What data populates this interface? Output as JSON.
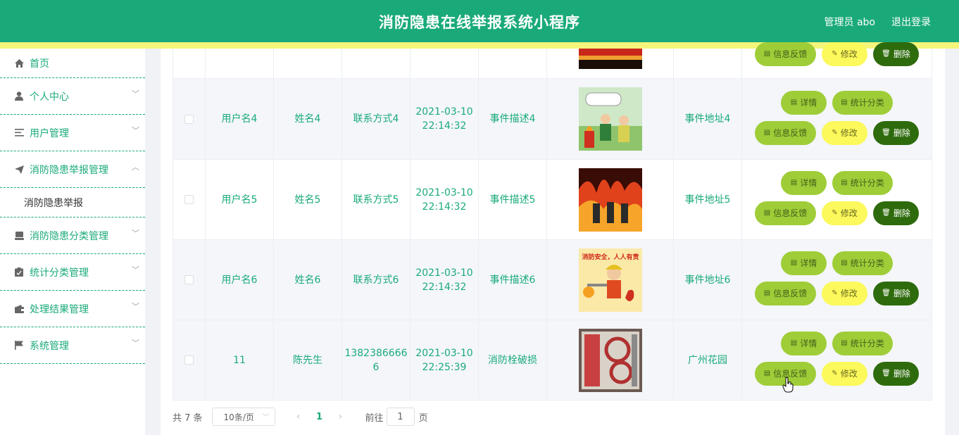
{
  "header": {
    "title": "消防隐患在线举报系统小程序",
    "admin": "管理员 abo",
    "logout": "退出登录"
  },
  "sidebar": {
    "items": [
      {
        "label": "首页",
        "icon": "home-icon"
      },
      {
        "label": "个人中心",
        "icon": "user-icon"
      },
      {
        "label": "用户管理",
        "icon": "list-icon"
      },
      {
        "label": "消防隐患举报管理",
        "icon": "send-icon"
      },
      {
        "label": "消防隐患分类管理",
        "icon": "tray-icon"
      },
      {
        "label": "统计分类管理",
        "icon": "clipboard-icon"
      },
      {
        "label": "处理结果管理",
        "icon": "wallet-icon"
      },
      {
        "label": "系统管理",
        "icon": "flag-icon"
      }
    ],
    "sub_item": "消防隐患举报"
  },
  "table": {
    "rows": [
      {
        "username": "用户名4",
        "name": "姓名4",
        "contact": "联系方式4",
        "date": "2021-03-10",
        "time": "22:14:32",
        "desc": "事件描述4",
        "address": "事件地址4",
        "image": "cartoon-fire-safety"
      },
      {
        "username": "用户名5",
        "name": "姓名5",
        "contact": "联系方式5",
        "date": "2021-03-10",
        "time": "22:14:32",
        "desc": "事件描述5",
        "address": "事件地址5",
        "image": "firefighters-flames"
      },
      {
        "username": "用户名6",
        "name": "姓名6",
        "contact": "联系方式6",
        "date": "2021-03-10",
        "time": "22:14:32",
        "desc": "事件描述6",
        "address": "事件地址6",
        "image": "fire-safety-poster"
      },
      {
        "username": "11",
        "name": "陈先生",
        "contact_line1": "1382386666",
        "contact_line2": "6",
        "date": "2021-03-10",
        "time": "22:25:39",
        "desc": "消防栓破损",
        "address": "广州花园",
        "image": "fire-hydrant-cabinet"
      }
    ],
    "buttons": {
      "detail": "详情",
      "stats": "统计分类",
      "feedback": "信息反馈",
      "edit": "修改",
      "delete": "删除"
    }
  },
  "pager": {
    "total": "共 7 条",
    "page_size": "10条/页",
    "current": "1",
    "goto": "前往",
    "page_unit": "页",
    "jump_value": "1"
  },
  "colors": {
    "primary": "#1aaa7a",
    "stripe": "#f4f57a",
    "btn_green": "#9fcd38",
    "btn_yellow": "#fbf95b",
    "btn_dark": "#2e6b0d"
  }
}
